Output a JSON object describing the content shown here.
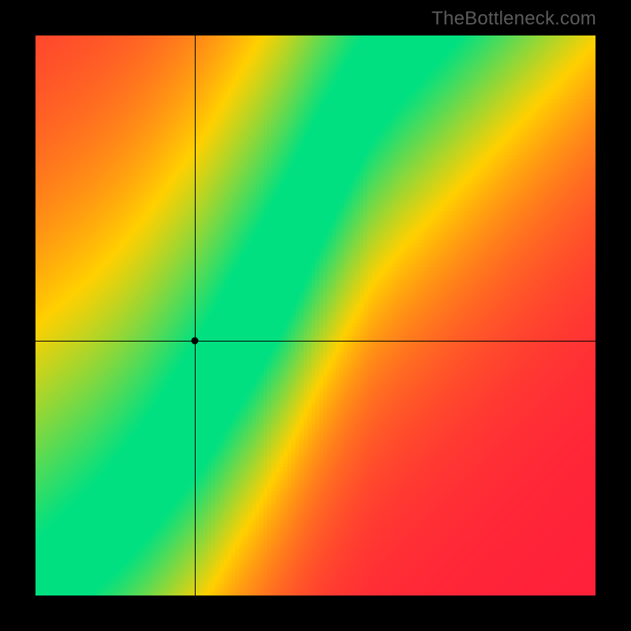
{
  "watermark": "TheBottleneck.com",
  "chart_data": {
    "type": "heatmap",
    "title": "",
    "xlabel": "",
    "ylabel": "",
    "xlim": [
      0,
      1
    ],
    "ylim": [
      0,
      1
    ],
    "grid": false,
    "colorscale": "red-yellow-green",
    "color_stops": [
      {
        "value": 0.0,
        "color": "#ff1f3a"
      },
      {
        "value": 0.5,
        "color": "#ffd000"
      },
      {
        "value": 1.0,
        "color": "#00e080"
      }
    ],
    "ideal_curve": {
      "description": "Optimal ratio band (green ridge) between the two axes; approximate center line sampled along horizontal axis.",
      "x": [
        0.0,
        0.05,
        0.1,
        0.15,
        0.2,
        0.25,
        0.3,
        0.35,
        0.4,
        0.45,
        0.5,
        0.55,
        0.6,
        0.65,
        0.68
      ],
      "y": [
        0.0,
        0.04,
        0.08,
        0.13,
        0.19,
        0.26,
        0.33,
        0.42,
        0.51,
        0.61,
        0.72,
        0.82,
        0.91,
        0.97,
        1.0
      ],
      "band_halfwidth": 0.028
    },
    "marker": {
      "x": 0.285,
      "y": 0.455,
      "label": ""
    },
    "pixel_resolution": 140
  }
}
